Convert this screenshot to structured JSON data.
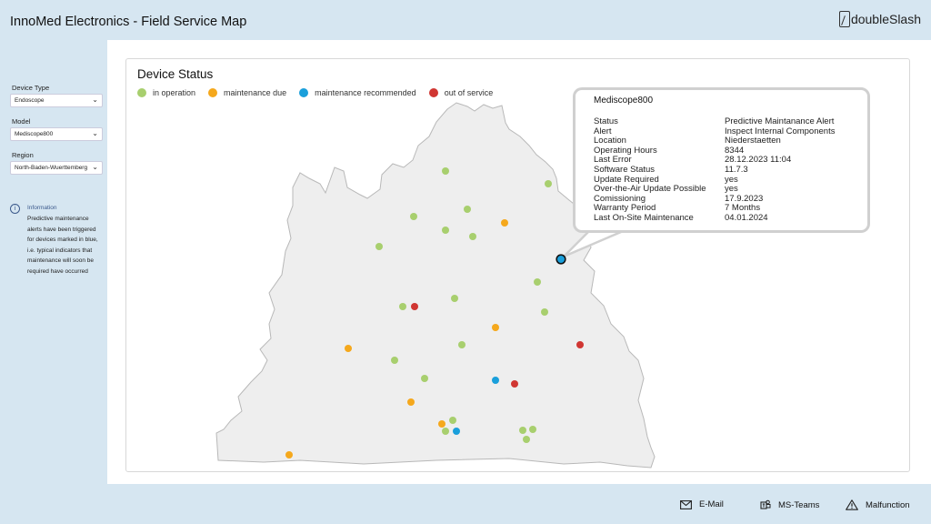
{
  "header": {
    "title": "InnoMed Electronics - Field Service Map",
    "logo_text": "doubleSlash"
  },
  "sidebar": {
    "device_type_label": "Device Type",
    "device_type_value": "Endoscope",
    "model_label": "Model",
    "model_value": "Mediscope800",
    "region_label": "Region",
    "region_value": "North-Baden-Wuerttemberg",
    "info_title": "Information",
    "info_text": "Predictive maintenance alerts have been triggered for devices marked in blue, i.e. typical indicators that maintenance will soon be required have occurred"
  },
  "panel": {
    "title": "Device Status"
  },
  "colors": {
    "in_operation": "#a8cf6e",
    "maintenance_due": "#f5a81c",
    "maintenance_recommended": "#1a9fdb",
    "out_of_service": "#d03632"
  },
  "legend": [
    {
      "label": "in operation",
      "status": "in_operation"
    },
    {
      "label": "maintenance due",
      "status": "maintenance_due"
    },
    {
      "label": "maintenance recommended",
      "status": "maintenance_recommended"
    },
    {
      "label": "out of service",
      "status": "out_of_service"
    }
  ],
  "popup": {
    "title": "Mediscope800",
    "rows": [
      {
        "key": "Status",
        "value": "Predictive Maintanance Alert"
      },
      {
        "key": "Alert",
        "value": "Inspect Internal Components"
      },
      {
        "key": "Location",
        "value": "Niederstaetten"
      },
      {
        "key": "Operating Hours",
        "value": "8344"
      },
      {
        "key": "Last Error",
        "value": "28.12.2023 11:04"
      },
      {
        "key": "Software Status",
        "value": "11.7.3"
      },
      {
        "key": "Update Required",
        "value": "yes"
      },
      {
        "key": "Over-the-Air Update Possible",
        "value": "yes"
      },
      {
        "key": "Comissioning",
        "value": "17.9.2023"
      },
      {
        "key": "Warranty Period",
        "value": "7 Months"
      },
      {
        "key": "Last On-Site Maintenance",
        "value": "04.01.2024"
      }
    ]
  },
  "footer": {
    "email_label": "E-Mail",
    "teams_label": "MS-Teams",
    "malfunction_label": "Malfunction"
  }
}
